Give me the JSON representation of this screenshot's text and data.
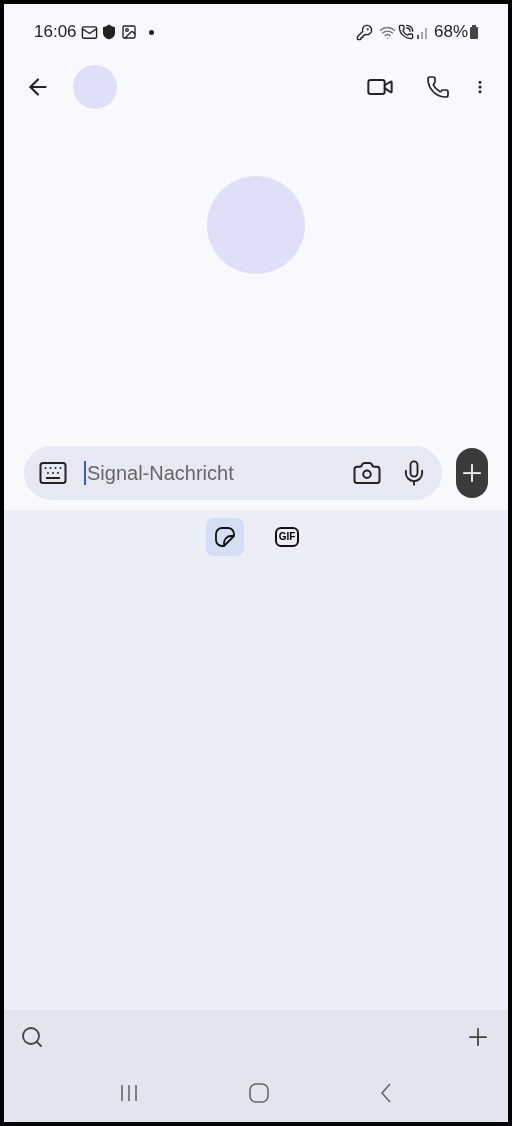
{
  "status_bar": {
    "time": "16:06",
    "battery": "68%"
  },
  "composer": {
    "placeholder": "Signal-Nachricht"
  },
  "media_tabs": [
    {
      "kind": "sticker",
      "selected": true
    },
    {
      "kind": "gif",
      "label": "GIF",
      "selected": false
    }
  ]
}
